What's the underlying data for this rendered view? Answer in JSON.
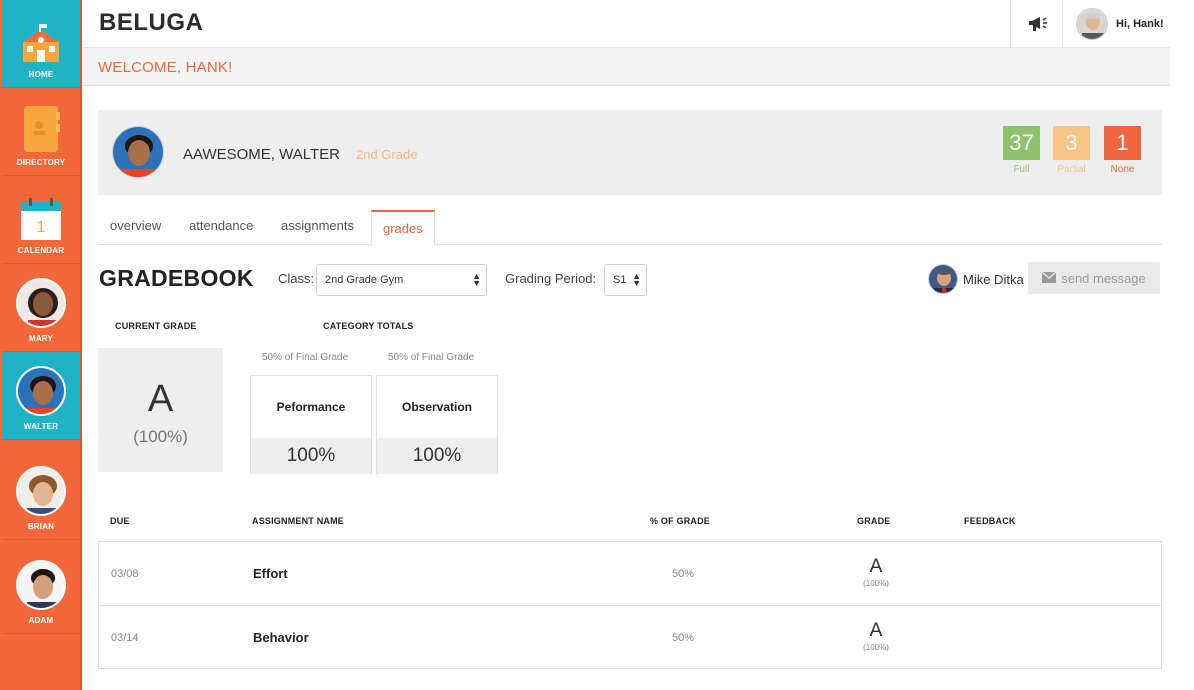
{
  "app": {
    "brand": "BELUGA",
    "welcome": "WELCOME, HANK!",
    "user_greeting": "Hi, Hank!"
  },
  "sidebar": {
    "items": [
      {
        "label": "HOME",
        "icon": "school-icon",
        "active": false
      },
      {
        "label": "DIRECTORY",
        "icon": "directory-book-icon",
        "active": false
      },
      {
        "label": "CALENDAR",
        "icon": "calendar-icon",
        "active": false,
        "icon_text": "1"
      },
      {
        "label": "MARY",
        "icon": "avatar",
        "active": false
      },
      {
        "label": "WALTER",
        "icon": "avatar",
        "active": true
      },
      {
        "label": "BRIAN",
        "icon": "avatar",
        "active": false
      },
      {
        "label": "ADAM",
        "icon": "avatar",
        "active": false
      }
    ]
  },
  "student": {
    "name": "AAWESOME, WALTER",
    "grade": "2nd Grade",
    "stats": [
      {
        "value": "37",
        "label": "Full",
        "color": "#8fc16f"
      },
      {
        "value": "3",
        "label": "Partial",
        "color": "#f8c586"
      },
      {
        "value": "1",
        "label": "None",
        "color": "#f0663d"
      }
    ]
  },
  "tabs": [
    "overview",
    "attendance",
    "assignments",
    "grades"
  ],
  "active_tab": "grades",
  "gradebook": {
    "title": "GRADEBOOK",
    "class_label": "Class:",
    "class_value": "2nd Grade Gym",
    "period_label": "Grading Period:",
    "period_value": "S1",
    "teacher": "Mike Ditka",
    "send_message": "send message",
    "current_grade_header": "CURRENT GRADE",
    "current_grade_letter": "A",
    "current_grade_pct": "(100%)",
    "category_totals_header": "CATEGORY TOTALS",
    "categories": [
      {
        "note": "50% of Final Grade",
        "name": "Peformance",
        "value": "100%"
      },
      {
        "note": "50% of Final Grade",
        "name": "Observation",
        "value": "100%"
      }
    ]
  },
  "table": {
    "headers": {
      "due": "DUE",
      "name": "ASSIGNMENT NAME",
      "pct": "% OF GRADE",
      "grade": "GRADE",
      "feedback": "FEEDBACK"
    },
    "rows": [
      {
        "due": "03/08",
        "name": "Effort",
        "pct": "50%",
        "grade": "A",
        "grade_pct": "(100%)",
        "feedback": ""
      },
      {
        "due": "03/14",
        "name": "Behavior",
        "pct": "50%",
        "grade": "A",
        "grade_pct": "(100%)",
        "feedback": ""
      }
    ]
  },
  "colors": {
    "accent": "#f0663d",
    "sidebar": "#f3673a",
    "active_teal": "#1eb4c6"
  }
}
